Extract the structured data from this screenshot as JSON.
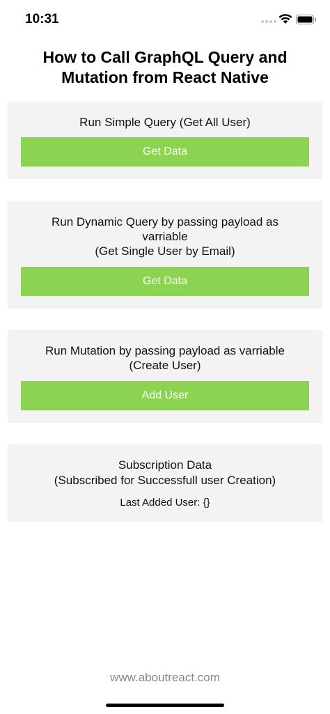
{
  "status_bar": {
    "time": "10:31"
  },
  "title": "How to Call GraphQL Query and Mutation from React Native",
  "cards": [
    {
      "description": "Run Simple Query (Get All User)",
      "button_label": "Get Data"
    },
    {
      "description_line1": "Run Dynamic Query by passing payload as varriable",
      "description_line2": "(Get Single User by Email)",
      "button_label": "Get Data"
    },
    {
      "description_line1": "Run Mutation by passing payload as varriable",
      "description_line2": "(Create User)",
      "button_label": "Add User"
    },
    {
      "description_line1": "Subscription Data",
      "description_line2": "(Subscribed for Successfull user Creation)",
      "last_added_label": "Last Added User: {}"
    }
  ],
  "footer": {
    "link": "www.aboutreact.com"
  },
  "colors": {
    "button": "#8bd350",
    "card_bg": "#f3f3f3",
    "footer_text": "#888888"
  },
  "icons": [
    "signal-icon",
    "wifi-icon",
    "battery-icon"
  ]
}
